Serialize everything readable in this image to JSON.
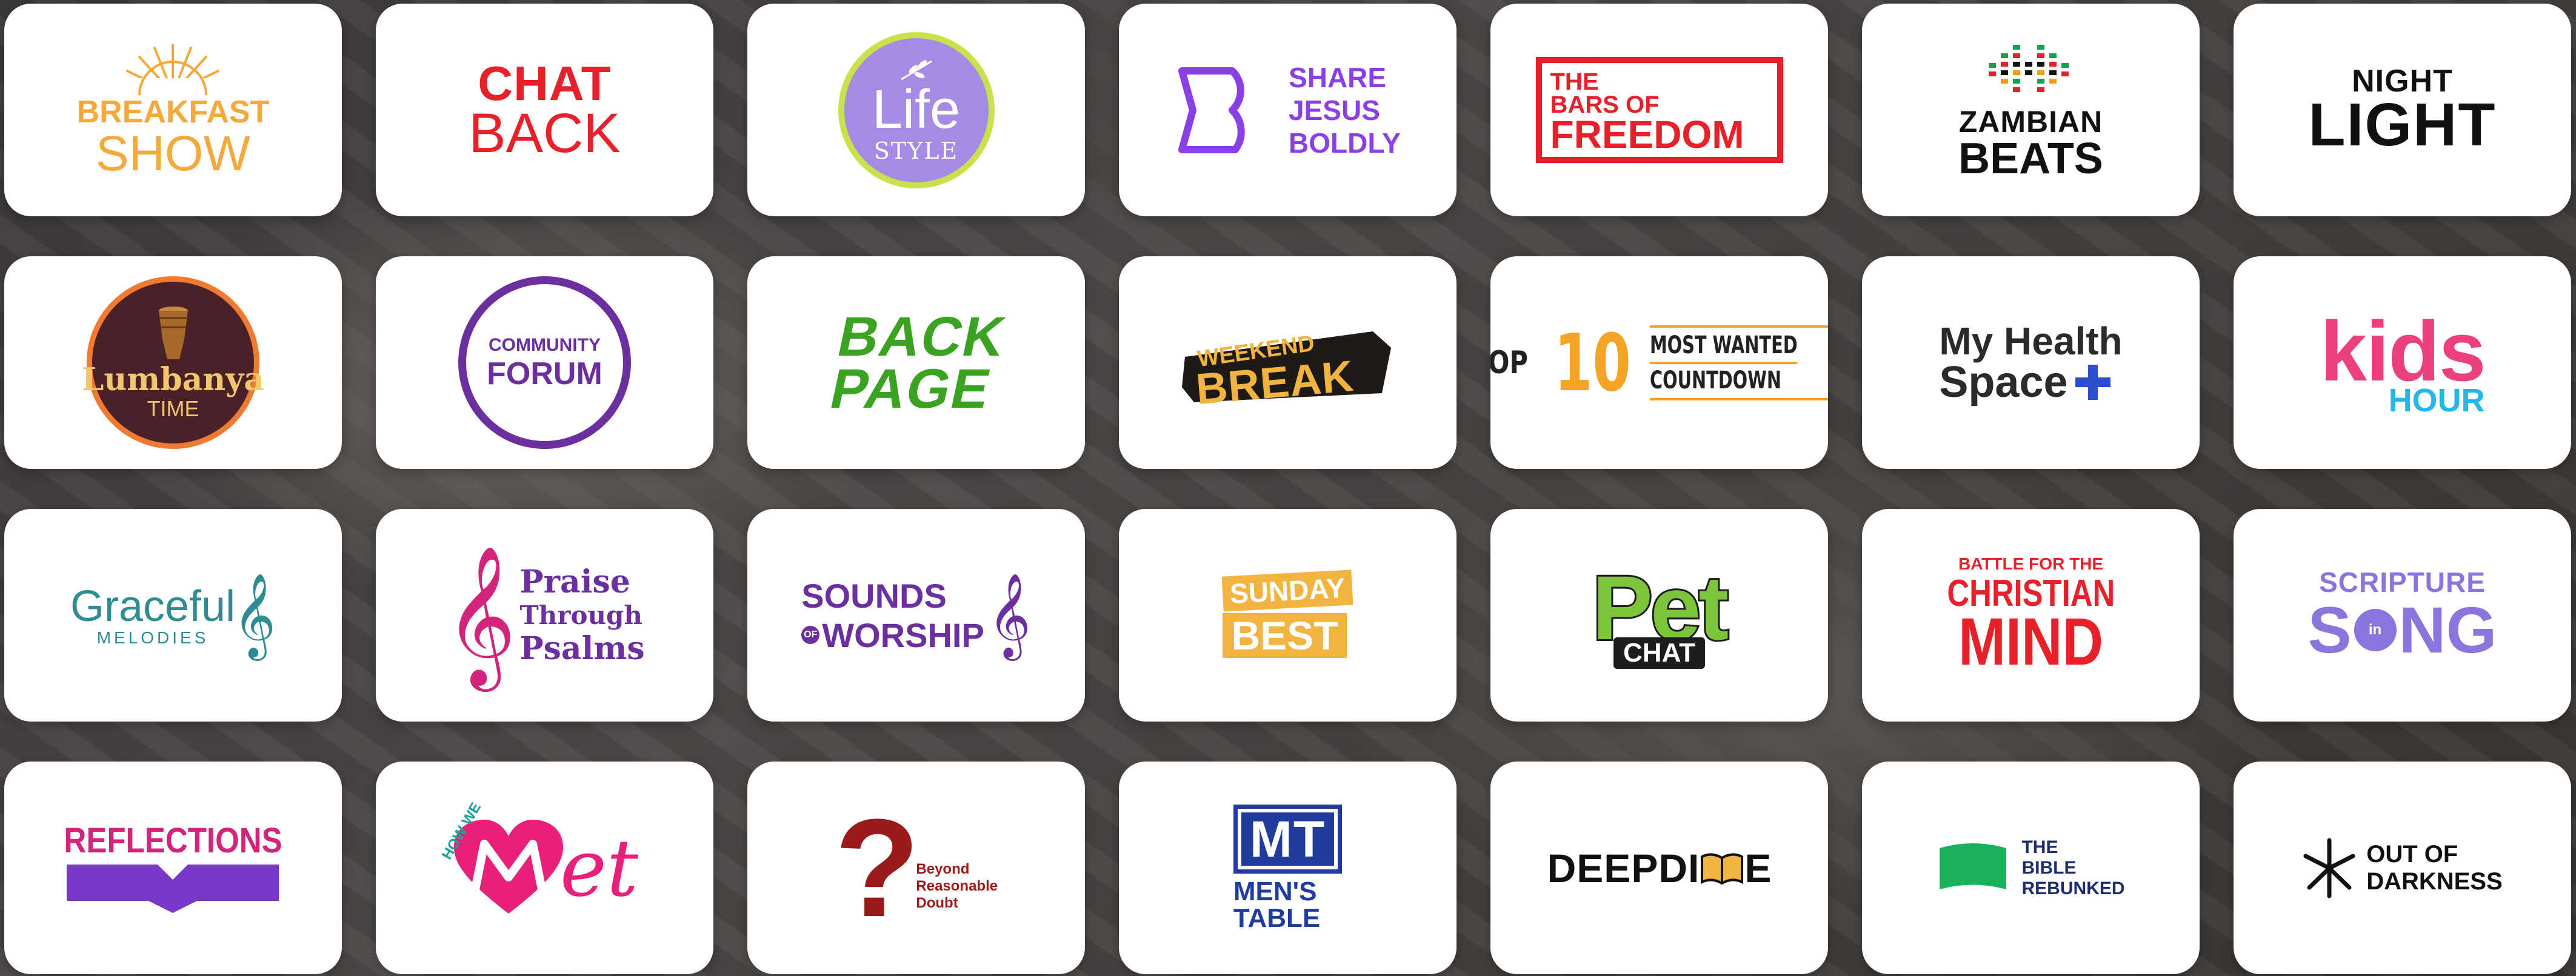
{
  "tiles": [
    {
      "name": "breakfast-show",
      "l1": "BREAKFAST",
      "l2": "SHOW"
    },
    {
      "name": "chat-back",
      "l1": "CHAT",
      "l2": "BACK"
    },
    {
      "name": "life-style",
      "l1": "Life",
      "l2": "STYLE"
    },
    {
      "name": "share-jesus-boldly",
      "l1": "SHARE",
      "l2": "JESUS",
      "l3": "BOLDLY"
    },
    {
      "name": "bars-of-freedom",
      "l1": "THE",
      "l2": "BARS OF",
      "l3": "FREEDOM"
    },
    {
      "name": "zambian-beats",
      "l1": "ZAMBIAN",
      "l2": "BEATS"
    },
    {
      "name": "night-light",
      "l1": "NIGHT",
      "l2": "LIGHT"
    },
    {
      "name": "lumbanya-time",
      "l1": "Lumbanya",
      "l2": "TIME"
    },
    {
      "name": "community-forum",
      "l1": "COMMUNITY",
      "l2": "FORUM"
    },
    {
      "name": "back-page",
      "l1": "BACK",
      "l2": "PAGE"
    },
    {
      "name": "weekend-break",
      "l1": "WEEKEND",
      "l2": "BREAK"
    },
    {
      "name": "top-10-countdown",
      "l1": "TOP",
      "l2": "10",
      "l3": "MOST WANTED",
      "l4": "COUNTDOWN"
    },
    {
      "name": "my-health-space",
      "l1": "My Health",
      "l2": "Space"
    },
    {
      "name": "kids-hour",
      "l1": "kids",
      "l2": "HOUR"
    },
    {
      "name": "graceful-melodies",
      "l1": "Graceful",
      "l2": "MELODIES"
    },
    {
      "name": "praise-through-psalms",
      "l1": "Praise",
      "l2": "Through",
      "l3": "Psalms"
    },
    {
      "name": "sounds-of-worship",
      "l1": "SOUNDS",
      "l2": "OF",
      "l3": "WORSHIP"
    },
    {
      "name": "sunday-best",
      "l1": "SUNDAY",
      "l2": "BEST"
    },
    {
      "name": "pet-chat",
      "l1": "Pet",
      "l2": "CHAT"
    },
    {
      "name": "battle-for-christian-mind",
      "l1": "BATTLE FOR THE",
      "l2": "CHRISTIAN",
      "l3": "MIND"
    },
    {
      "name": "scripture-in-song",
      "l1": "SCRIPTURE",
      "l2": "S",
      "l3": "in",
      "l4": "NG"
    },
    {
      "name": "reflections",
      "l1": "REFLECTIONS"
    },
    {
      "name": "how-we-met",
      "l1": "HOW WE",
      "l2": "et"
    },
    {
      "name": "beyond-reasonable-doubt",
      "l1": "?",
      "l2": "Beyond",
      "l3": "Reasonable",
      "l4": "Doubt"
    },
    {
      "name": "mens-table",
      "l1": "MT",
      "l2": "MEN'S",
      "l3": "TABLE"
    },
    {
      "name": "deep-dive",
      "l1": "DEEPDI",
      "l2": "E"
    },
    {
      "name": "bible-rebunked",
      "l1": "THE",
      "l2": "BIBLE",
      "l3": "REBUNKED"
    },
    {
      "name": "out-of-darkness",
      "l1": "OUT OF",
      "l2": "DARKNESS"
    }
  ],
  "colors": {
    "orange": "#f6a93b",
    "red": "#e8202a",
    "lilac": "#9f7fe3",
    "lime": "#c7e34a",
    "purple": "#8b3fe6",
    "deepPurple": "#6b2fa0",
    "green": "#3aa322",
    "teal": "#2e8d92",
    "magenta": "#d2247a",
    "pink": "#ec3f7f",
    "cyan": "#27b6e8",
    "darkRed": "#9b1a1a",
    "navy": "#1f3c9e",
    "scripture": "#8b74dc",
    "bibleGreen": "#19b15a",
    "gold": "#f3b43f"
  }
}
